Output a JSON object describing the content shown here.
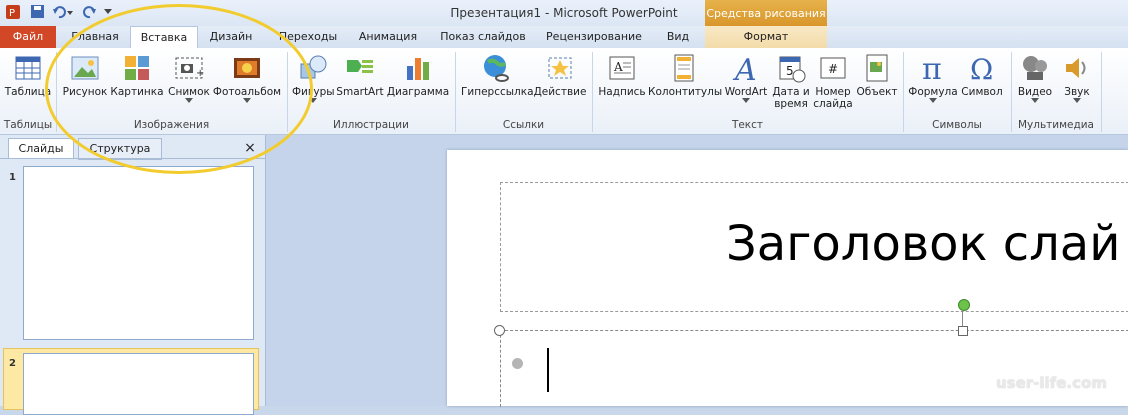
{
  "window": {
    "title": "Презентация1 - Microsoft PowerPoint"
  },
  "contextual": {
    "label": "Средства рисования",
    "tab": "Формат"
  },
  "tabs": {
    "file": "Файл",
    "home": "Главная",
    "insert": "Вставка",
    "design": "Дизайн",
    "transitions": "Переходы",
    "animation": "Анимация",
    "slideshow": "Показ слайдов",
    "review": "Рецензирование",
    "view": "Вид"
  },
  "ribbon": {
    "buttons": {
      "table": "Таблица",
      "picture": "Рисунок",
      "clipart": "Картинка",
      "screenshot": "Снимок",
      "photoalbum": "Фотоальбом",
      "shapes": "Фигуры",
      "smartart": "SmartArt",
      "chart": "Диаграмма",
      "hyperlink": "Гиперссылка",
      "action": "Действие",
      "textbox": "Надпись",
      "headerfooter": "Колонтитулы",
      "wordart": "WordArt",
      "datetime": "Дата и время",
      "slidenumber": "Номер слайда",
      "object": "Объект",
      "equation": "Формула",
      "symbol": "Символ",
      "video": "Видео",
      "audio": "Звук"
    },
    "groups": {
      "tables": "Таблицы",
      "images": "Изображения",
      "illustrations": "Иллюстрации",
      "links": "Ссылки",
      "text": "Текст",
      "symbols": "Символы",
      "media": "Мультимедиа"
    }
  },
  "pane": {
    "tab_slides": "Слайды",
    "tab_outline": "Структура",
    "close": "×",
    "slide1": "1",
    "slide2": "2"
  },
  "slide": {
    "title_text": "Заголовок слай"
  },
  "watermark": "user-life.com",
  "colors": {
    "file_tab": "#d24726",
    "highlight_ellipse": "#f2cc2e",
    "contextual": "#d9962a"
  }
}
